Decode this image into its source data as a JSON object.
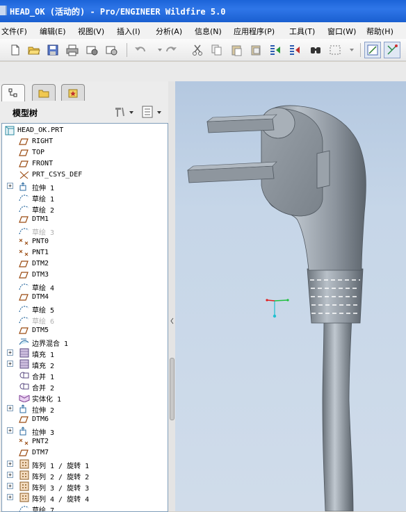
{
  "window": {
    "title": "HEAD_OK (活动的) - Pro/ENGINEER Wildfire 5.0"
  },
  "menu": [
    {
      "label": "文件(F)"
    },
    {
      "label": "编辑(E)"
    },
    {
      "label": "视图(V)"
    },
    {
      "label": "插入(I)"
    },
    {
      "label": "分析(A)"
    },
    {
      "label": "信息(N)"
    },
    {
      "label": "应用程序(P)"
    },
    {
      "label": "工具(T)"
    },
    {
      "label": "窗口(W)"
    },
    {
      "label": "帮助(H)"
    }
  ],
  "toolbar": {
    "icons": [
      "new-file-icon",
      "open-folder-icon",
      "save-icon",
      "print-icon",
      "email-icon",
      "email-attach-icon",
      "undo-icon",
      "redo-icon",
      "cut-icon",
      "copy-icon",
      "paste-icon",
      "paste-special-icon",
      "regenerate-icon",
      "regenerate-manager-icon",
      "find-icon",
      "select-box-icon",
      "sketch-view-icon",
      "datum-display-icon"
    ]
  },
  "panel": {
    "tree_title": "模型树",
    "tabs": [
      "model-tree-tab",
      "folder-browser-tab",
      "favorites-tab"
    ]
  },
  "tree": {
    "root": "HEAD_OK.PRT",
    "items": [
      {
        "label": "RIGHT",
        "icon": "datum-plane",
        "expandable": false,
        "dim": false
      },
      {
        "label": "TOP",
        "icon": "datum-plane",
        "expandable": false,
        "dim": false
      },
      {
        "label": "FRONT",
        "icon": "datum-plane",
        "expandable": false,
        "dim": false
      },
      {
        "label": "PRT_CSYS_DEF",
        "icon": "csys",
        "expandable": false,
        "dim": false
      },
      {
        "label": "拉伸 1",
        "icon": "extrude",
        "expandable": true,
        "dim": false
      },
      {
        "label": "草绘 1",
        "icon": "sketch",
        "expandable": false,
        "dim": false
      },
      {
        "label": "草绘 2",
        "icon": "sketch",
        "expandable": false,
        "dim": false
      },
      {
        "label": "DTM1",
        "icon": "datum-plane",
        "expandable": false,
        "dim": false
      },
      {
        "label": "草绘 3",
        "icon": "sketch",
        "expandable": false,
        "dim": true
      },
      {
        "label": "PNT0",
        "icon": "datum-point",
        "expandable": false,
        "dim": false
      },
      {
        "label": "PNT1",
        "icon": "datum-point",
        "expandable": false,
        "dim": false
      },
      {
        "label": "DTM2",
        "icon": "datum-plane",
        "expandable": false,
        "dim": false
      },
      {
        "label": "DTM3",
        "icon": "datum-plane",
        "expandable": false,
        "dim": false
      },
      {
        "label": "草绘 4",
        "icon": "sketch",
        "expandable": false,
        "dim": false
      },
      {
        "label": "DTM4",
        "icon": "datum-plane",
        "expandable": false,
        "dim": false
      },
      {
        "label": "草绘 5",
        "icon": "sketch",
        "expandable": false,
        "dim": false
      },
      {
        "label": "草绘 6",
        "icon": "sketch",
        "expandable": false,
        "dim": true
      },
      {
        "label": "DTM5",
        "icon": "datum-plane",
        "expandable": false,
        "dim": false
      },
      {
        "label": "边界混合 1",
        "icon": "boundary-blend",
        "expandable": false,
        "dim": false
      },
      {
        "label": "填充 1",
        "icon": "fill",
        "expandable": true,
        "dim": false
      },
      {
        "label": "填充 2",
        "icon": "fill",
        "expandable": true,
        "dim": false
      },
      {
        "label": "合并 1",
        "icon": "merge",
        "expandable": false,
        "dim": false
      },
      {
        "label": "合并 2",
        "icon": "merge",
        "expandable": false,
        "dim": false
      },
      {
        "label": "实体化 1",
        "icon": "solidify",
        "expandable": false,
        "dim": false
      },
      {
        "label": "拉伸 2",
        "icon": "extrude",
        "expandable": true,
        "dim": false
      },
      {
        "label": "DTM6",
        "icon": "datum-plane",
        "expandable": false,
        "dim": false
      },
      {
        "label": "拉伸 3",
        "icon": "extrude",
        "expandable": true,
        "dim": false
      },
      {
        "label": "PNT2",
        "icon": "datum-point",
        "expandable": false,
        "dim": false
      },
      {
        "label": "DTM7",
        "icon": "datum-plane",
        "expandable": false,
        "dim": false
      },
      {
        "label": "阵列 1 / 旋转 1",
        "icon": "pattern",
        "expandable": true,
        "dim": false
      },
      {
        "label": "阵列 2 / 旋转 2",
        "icon": "pattern",
        "expandable": true,
        "dim": false
      },
      {
        "label": "阵列 3 / 旋转 3",
        "icon": "pattern",
        "expandable": true,
        "dim": false
      },
      {
        "label": "阵列 4 / 旋转 4",
        "icon": "pattern",
        "expandable": true,
        "dim": false
      },
      {
        "label": "草绘 7",
        "icon": "sketch",
        "expandable": false,
        "dim": false
      }
    ]
  },
  "colors": {
    "title_bar": "#1c64d8",
    "viewport_bg": "#c6d6e8",
    "model_gray": "#9aa2ac",
    "tree_border": "#7f9db9"
  }
}
